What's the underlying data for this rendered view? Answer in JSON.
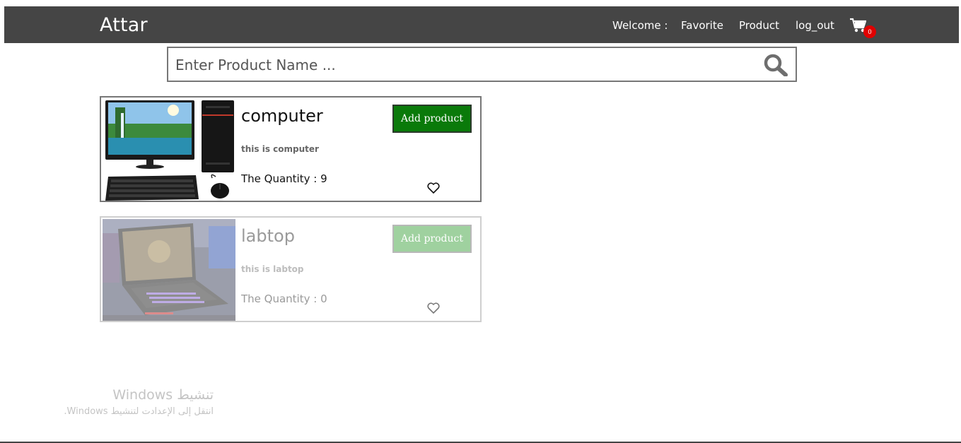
{
  "navbar": {
    "brand": "Attar",
    "welcome": "Welcome :",
    "favorite": "Favorite",
    "product": "Product",
    "logout": "log_out",
    "cart_count": "0",
    "cart_icon": "cart-icon"
  },
  "search": {
    "placeholder": "Enter Product Name ...",
    "icon": "search-icon"
  },
  "products": [
    {
      "name": "computer",
      "description": "this is computer",
      "quantity": "The Quantity : 9",
      "button": "Add product",
      "available": true
    },
    {
      "name": "labtop",
      "description": "this is labtop",
      "quantity": "The Quantity : 0",
      "button": "Add product",
      "available": false
    }
  ],
  "watermark": {
    "title": "تنشيط Windows",
    "subtitle": "انتقل إلى الإعدادت لتنشيط Windows."
  },
  "colors": {
    "navbar": "#454545",
    "add_button": "#0a7a0a",
    "add_button_disabled": "#9fd19f",
    "badge": "#e00000"
  }
}
